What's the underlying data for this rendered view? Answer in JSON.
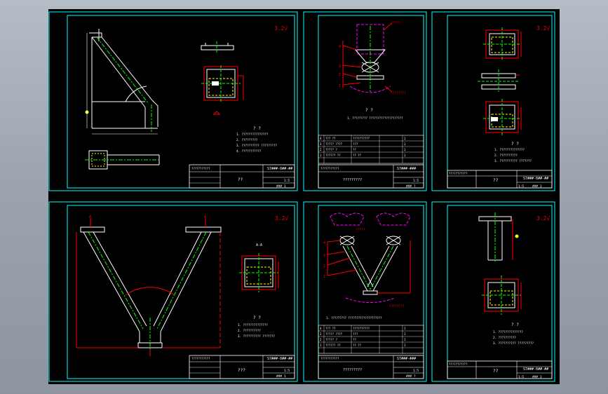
{
  "colors": {
    "background": "#000000",
    "frame": "#00ffff",
    "part": "#ffffff",
    "centerline": "#00ff00",
    "dimension": "#ff0000",
    "hidden": "#ff00ff",
    "note": "#ffff00",
    "surround": "#9aa3ad"
  },
  "sheets": [
    {
      "drawing_no": "S7###-0##-##",
      "title": "??",
      "notes_heading": "? ?",
      "notes": [
        "1. ???????????????",
        "2. ?????????",
        "3. ?????????? ?????????",
        "4. ???????????"
      ],
      "scale": "1:5",
      "sheet_mark": "### 1"
    },
    {
      "drawing_no": "S7###-###",
      "title": "?????????",
      "notes_heading": "? ?",
      "notes": [
        "1. ?????????  ????????????????????"
      ],
      "bom_rows": [
        [
          "4",
          "??? ??",
          "??????????",
          "1"
        ],
        [
          "3",
          "????? ????",
          "???",
          "1"
        ],
        [
          "2",
          "????? ?",
          "??",
          "1"
        ],
        [
          "1",
          "?????? ??",
          "?? ??",
          "1"
        ]
      ],
      "scale": "1:5",
      "sheet_mark": "### ?"
    },
    {
      "drawing_no": "S7###-0##-##",
      "title": "??",
      "notes_heading": "? ?",
      "notes": [
        "1. ??????????????",
        "2. ??????????",
        "3. ?????????? ???????"
      ],
      "scale": "1:5",
      "sheet_mark": "### 1"
    },
    {
      "drawing_no": "S7###-0##-##",
      "title": "???",
      "notes_heading": "? ?",
      "notes": [
        "1. ??????????????",
        "2. ??????????",
        "3. ?????????? ???????"
      ],
      "scale": "1:5",
      "sheet_mark": "### 1"
    },
    {
      "drawing_no": "S7###-###",
      "title": "?????????",
      "notes_heading": "? ?",
      "notes": [
        "1. ?????????  ????????????????????"
      ],
      "bom_rows": [
        [
          "4",
          "??? ??",
          "??????????",
          "1"
        ],
        [
          "3",
          "????? ????",
          "???",
          "1"
        ],
        [
          "2",
          "????? ?",
          "??",
          "1"
        ],
        [
          "1",
          "?????? ??",
          "?? ??",
          "1"
        ]
      ],
      "scale": "1:5",
      "sheet_mark": "### ?"
    },
    {
      "drawing_no": "S7###-0##-##",
      "title": "??",
      "notes_heading": "? ?",
      "notes": [
        "1. ??????????????",
        "2. ??????????",
        "3. ?????????? ?????????"
      ],
      "scale": "1:5",
      "sheet_mark": "### 1"
    }
  ],
  "labels": {
    "section_a": "A",
    "callout_1": "?????",
    "callout_2": "????????"
  }
}
